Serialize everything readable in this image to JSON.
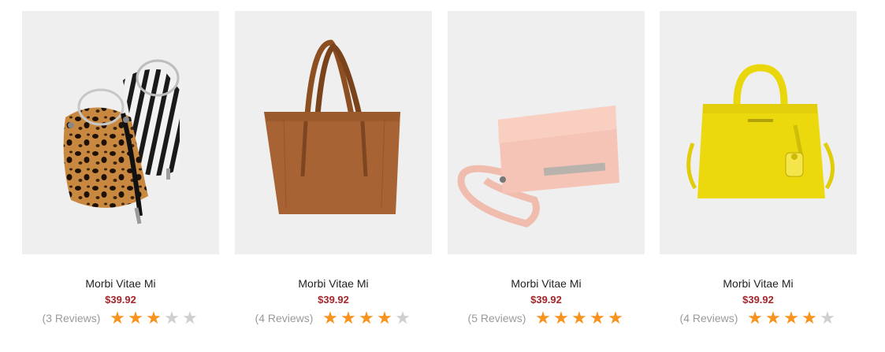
{
  "colors": {
    "star_on": "#f7931e",
    "star_off": "#cfcfcf",
    "price": "#a3262b",
    "tile_bg": "#efefef"
  },
  "products": [
    {
      "name": "Morbi Vitae Mi",
      "price": "$39.92",
      "reviews": "(3 Reviews)",
      "rating": 3,
      "image": "leopard-and-zebra-bucket-bags"
    },
    {
      "name": "Morbi Vitae Mi",
      "price": "$39.92",
      "reviews": "(4 Reviews)",
      "rating": 4,
      "image": "brown-suede-tote-bag"
    },
    {
      "name": "Morbi Vitae Mi",
      "price": "$39.92",
      "reviews": "(5 Reviews)",
      "rating": 5,
      "image": "pink-crossbody-clutch"
    },
    {
      "name": "Morbi Vitae Mi",
      "price": "$39.92",
      "reviews": "(4 Reviews)",
      "rating": 4,
      "image": "yellow-structured-handbag"
    }
  ]
}
